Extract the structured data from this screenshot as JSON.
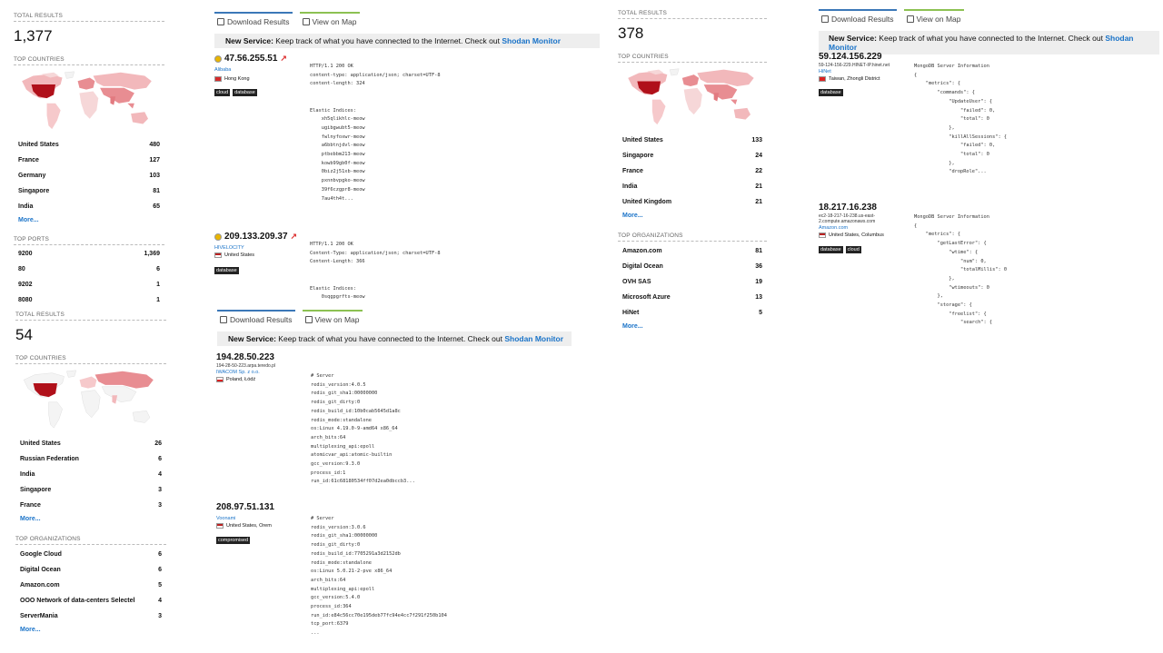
{
  "colors": {
    "accent": "#1a73c8",
    "banner_bg": "#eeeeee",
    "tab_blue": "#3b78b8",
    "tab_green": "#8cc152",
    "tag_bg": "#222222",
    "map_dark": "#b0101a",
    "map_mid": "#e88d92",
    "map_light": "#f6c9cb"
  },
  "icons": {
    "download": "download-icon",
    "map": "map-icon",
    "external": "external-link-icon"
  },
  "tabs": {
    "download": "Download Results",
    "map": "View on Map"
  },
  "banner": {
    "label": "New Service:",
    "text": "Keep track of what you have connected to the Internet. Check out",
    "link": "Shodan Monitor"
  },
  "panel1": {
    "total_title": "TOTAL RESULTS",
    "total": "1,377",
    "countries_title": "TOP COUNTRIES",
    "countries": [
      {
        "name": "United States",
        "count": "480"
      },
      {
        "name": "France",
        "count": "127"
      },
      {
        "name": "Germany",
        "count": "103"
      },
      {
        "name": "Singapore",
        "count": "81"
      },
      {
        "name": "India",
        "count": "65"
      }
    ],
    "more1": "More...",
    "ports_title": "TOP PORTS",
    "ports": [
      {
        "name": "9200",
        "count": "1,369"
      },
      {
        "name": "80",
        "count": "6"
      },
      {
        "name": "9202",
        "count": "1"
      },
      {
        "name": "8080",
        "count": "1"
      }
    ]
  },
  "panel2": {
    "total_title": "TOTAL RESULTS",
    "total": "54",
    "countries_title": "TOP COUNTRIES",
    "countries": [
      {
        "name": "United States",
        "count": "26"
      },
      {
        "name": "Russian Federation",
        "count": "6"
      },
      {
        "name": "India",
        "count": "4"
      },
      {
        "name": "Singapore",
        "count": "3"
      },
      {
        "name": "France",
        "count": "3"
      }
    ],
    "more1": "More...",
    "orgs_title": "TOP ORGANIZATIONS",
    "orgs": [
      {
        "name": "Google Cloud",
        "count": "6"
      },
      {
        "name": "Digital Ocean",
        "count": "6"
      },
      {
        "name": "Amazon.com",
        "count": "5"
      },
      {
        "name": "OOO Network of data-centers Selectel",
        "count": "4"
      },
      {
        "name": "ServerMania",
        "count": "3"
      }
    ],
    "more2": "More..."
  },
  "panel3": {
    "total_title": "TOTAL RESULTS",
    "total": "378",
    "countries_title": "TOP COUNTRIES",
    "countries": [
      {
        "name": "United States",
        "count": "133"
      },
      {
        "name": "Singapore",
        "count": "24"
      },
      {
        "name": "France",
        "count": "22"
      },
      {
        "name": "India",
        "count": "21"
      },
      {
        "name": "United Kingdom",
        "count": "21"
      }
    ],
    "more1": "More...",
    "orgs_title": "TOP ORGANIZATIONS",
    "orgs": [
      {
        "name": "Amazon.com",
        "count": "81"
      },
      {
        "name": "Digital Ocean",
        "count": "36"
      },
      {
        "name": "OVH SAS",
        "count": "19"
      },
      {
        "name": "Microsoft Azure",
        "count": "13"
      },
      {
        "name": "HiNet",
        "count": "5"
      }
    ],
    "more2": "More..."
  },
  "results": {
    "r1": {
      "ip": "47.56.255.51",
      "org": "Alibaba",
      "location": "Hong Kong",
      "tags": [
        "cloud",
        "database"
      ],
      "banner": "HTTP/1.1 200 OK\ncontent-type: application/json; charset=UTF-8\ncontent-length: 324\n\n\nElastic Indices:\n    xh5qlikhlc-meow\n    ugibgwubt5-meow\n    fwlnyfoxwr-meow\n    a6bbtnjdvl-meow\n    ptbebbm213-meow\n    kowb99gb0f-meow\n    0biz2j51xb-meow\n    pxnnbvpgko-meow\n    39f6czgpr8-meow\n    7au4th4t..."
    },
    "r2": {
      "ip": "209.133.209.37",
      "org": "HIVELOCITY",
      "location": "United States",
      "tags": [
        "database"
      ],
      "banner": "HTTP/1.1 200 OK\nContent-Type: application/json; charset=UTF-8\nContent-Length: 366\n\n\nElastic Indices:\n    0sqgpgrfts-meow"
    },
    "r3": {
      "ip": "194.28.50.223",
      "host": "194-28-50-223.arpa.teredo.pl",
      "org": "IWACOM Sp. z o.o.",
      "location": "Poland, Łódź",
      "tags": [],
      "banner": "# Server\nredis_version:4.0.5\nredis_git_sha1:00000000\nredis_git_dirty:0\nredis_build_id:10b0cab5645d1a8c\nredis_mode:standalone\nos:Linux 4.19.0-9-amd64 x86_64\narch_bits:64\nmultiplexing_api:epoll\natomicvar_api:atomic-builtin\ngcc_version:9.3.0\nprocess_id:1\nrun_id:61c68180534ff07d2ea0dbccb3..."
    },
    "r4": {
      "ip": "208.97.51.131",
      "org": "Voonami",
      "location": "United States, Orem",
      "tags": [
        "compromised"
      ],
      "banner": "# Server\nredis_version:3.0.6\nredis_git_sha1:00000000\nredis_git_dirty:0\nredis_build_id:7705291a3d2152db\nredis_mode:standalone\nos:Linux 5.0.21-2-pve x86_64\narch_bits:64\nmultiplexing_api:epoll\ngcc_version:5.4.0\nprocess_id:364\nrun_id:e84c56cc70e195deb77fc94e4cc7f291f250b104\ntcp_port:6379\n..."
    },
    "r5": {
      "ip": "59.124.156.229",
      "host": "59-124-156-229.HINET-IP.hinet.net",
      "org": "HiNet",
      "location": "Taiwan, Zhongli District",
      "tags": [
        "database"
      ],
      "banner": "MongoDB Server Information\n{\n    \"metrics\": {\n        \"commands\": {\n            \"UpdateUser\": {\n                \"failed\": 0,\n                \"total\": 0\n            },\n            \"killAllSessions\": {\n                \"failed\": 0,\n                \"total\": 0\n            },\n            \"dropRole\"..."
    },
    "r6": {
      "ip": "18.217.16.238",
      "host": "ec2-18-217-16-238.us-east-2.compute.amazonaws.com",
      "org": "Amazon.com",
      "location": "United States, Columbus",
      "tags": [
        "database",
        "cloud"
      ],
      "banner": "MongoDB Server Information\n{\n    \"metrics\": {\n        \"getLastError\": {\n            \"wtime\": {\n                \"num\": 0,\n                \"totalMillis\": 0\n            },\n            \"wtimeouts\": 0\n        },\n        \"storage\": {\n            \"freelist\": {\n                \"search\": {"
    }
  }
}
